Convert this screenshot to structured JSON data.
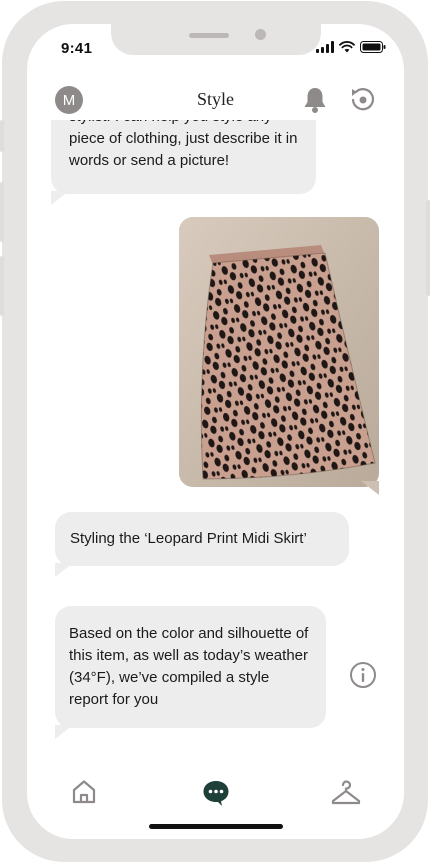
{
  "status_bar": {
    "time": "9:41"
  },
  "header": {
    "avatar_initial": "M",
    "title": "Style"
  },
  "messages": [
    {
      "sender": "assistant",
      "text": "stylist! I can help you style any piece of clothing, just describe it in words or send a picture!"
    },
    {
      "sender": "user",
      "type": "image",
      "image_icon": "leopard-print-midi-skirt-photo"
    },
    {
      "sender": "assistant",
      "text": "Styling the ‘Leopard Print Midi Skirt’"
    },
    {
      "sender": "assistant",
      "text": "Based on the color and silhouette of this item, as well as today’s weather (34°F), we’ve compiled a style report for you"
    }
  ],
  "tab_bar": {
    "items": [
      {
        "icon": "home-icon"
      },
      {
        "icon": "chat-icon",
        "active": true
      },
      {
        "icon": "hanger-icon"
      }
    ]
  },
  "colors": {
    "frame": "#e6e3e3",
    "bubble": "#eeeded",
    "accent": "#1f3f39",
    "icon_gray": "#8f8a8a"
  }
}
